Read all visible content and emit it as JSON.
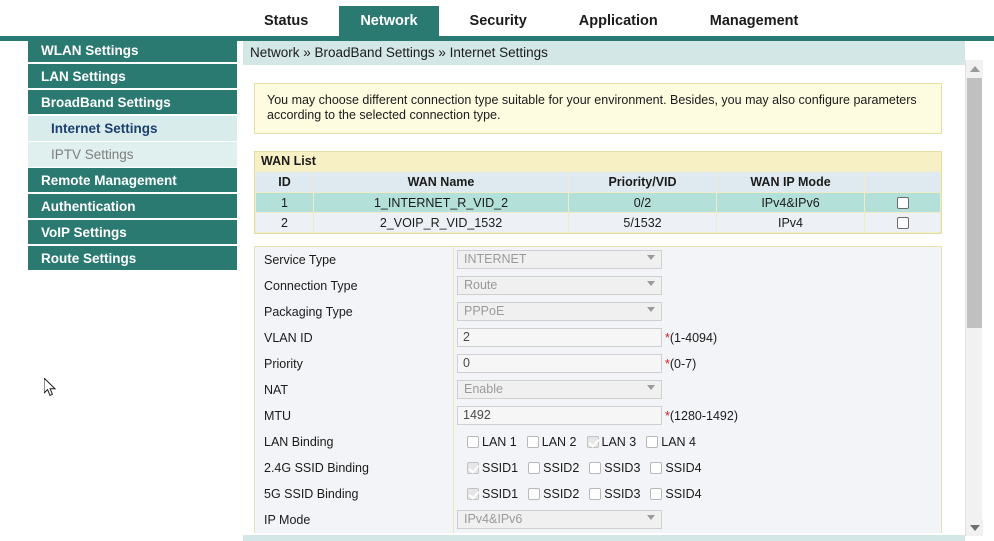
{
  "topnav": {
    "tabs": [
      {
        "label": "Status",
        "active": false
      },
      {
        "label": "Network",
        "active": true
      },
      {
        "label": "Security",
        "active": false
      },
      {
        "label": "Application",
        "active": false
      },
      {
        "label": "Management",
        "active": false
      }
    ]
  },
  "sidebar": {
    "items": [
      {
        "label": "WLAN Settings",
        "type": "group"
      },
      {
        "label": "LAN Settings",
        "type": "group"
      },
      {
        "label": "BroadBand Settings",
        "type": "group"
      },
      {
        "label": "Internet Settings",
        "type": "sub-active"
      },
      {
        "label": "IPTV Settings",
        "type": "sub"
      },
      {
        "label": "Remote Management",
        "type": "group"
      },
      {
        "label": "Authentication",
        "type": "group"
      },
      {
        "label": "VoIP Settings",
        "type": "group"
      },
      {
        "label": "Route Settings",
        "type": "group"
      }
    ]
  },
  "breadcrumb": {
    "text": "Network » BroadBand Settings » Internet Settings"
  },
  "notice": {
    "text": "You may choose different connection type suitable for your environment. Besides, you may also configure parameters according to the selected connection type."
  },
  "wan_list": {
    "title": "WAN List",
    "columns": [
      "ID",
      "WAN Name",
      "Priority/VID",
      "WAN IP Mode",
      ""
    ],
    "rows": [
      {
        "id": "1",
        "name": "1_INTERNET_R_VID_2",
        "priority_vid": "0/2",
        "ip_mode": "IPv4&IPv6",
        "selected": true,
        "checked": false
      },
      {
        "id": "2",
        "name": "2_VOIP_R_VID_1532",
        "priority_vid": "5/1532",
        "ip_mode": "IPv4",
        "selected": false,
        "checked": false
      }
    ]
  },
  "form": {
    "service_type": {
      "label": "Service Type",
      "value": "INTERNET",
      "disabled": true
    },
    "connection_type": {
      "label": "Connection Type",
      "value": "Route",
      "disabled": true
    },
    "packaging_type": {
      "label": "Packaging Type",
      "value": "PPPoE",
      "disabled": true
    },
    "vlan_id": {
      "label": "VLAN ID",
      "value": "2",
      "hint_star": "*",
      "hint": "(1-4094)"
    },
    "priority": {
      "label": "Priority",
      "value": "0",
      "hint_star": "*",
      "hint": "(0-7)"
    },
    "nat": {
      "label": "NAT",
      "value": "Enable",
      "disabled": true
    },
    "mtu": {
      "label": "MTU",
      "value": "1492",
      "hint_star": "*",
      "hint": "(1280-1492)"
    },
    "lan_binding": {
      "label": "LAN Binding",
      "options": [
        {
          "label": "LAN 1",
          "checked": false
        },
        {
          "label": "LAN 2",
          "checked": false
        },
        {
          "label": "LAN 3",
          "checked": true
        },
        {
          "label": "LAN 4",
          "checked": false
        }
      ]
    },
    "ssid_24g": {
      "label": "2.4G SSID Binding",
      "options": [
        {
          "label": "SSID1",
          "checked": true
        },
        {
          "label": "SSID2",
          "checked": false
        },
        {
          "label": "SSID3",
          "checked": false
        },
        {
          "label": "SSID4",
          "checked": false
        }
      ]
    },
    "ssid_5g": {
      "label": "5G SSID Binding",
      "options": [
        {
          "label": "SSID1",
          "checked": true
        },
        {
          "label": "SSID2",
          "checked": false
        },
        {
          "label": "SSID3",
          "checked": false
        },
        {
          "label": "SSID4",
          "checked": false
        }
      ]
    },
    "ip_mode": {
      "label": "IP Mode",
      "value": "IPv4&IPv6",
      "disabled": true
    }
  },
  "colors": {
    "teal": "#2b7a72",
    "breadcrumb_bg": "#d3e7e6",
    "notice_bg": "#fdfce0",
    "row_selected": "#b3e0d9",
    "required_star": "#d02020"
  }
}
